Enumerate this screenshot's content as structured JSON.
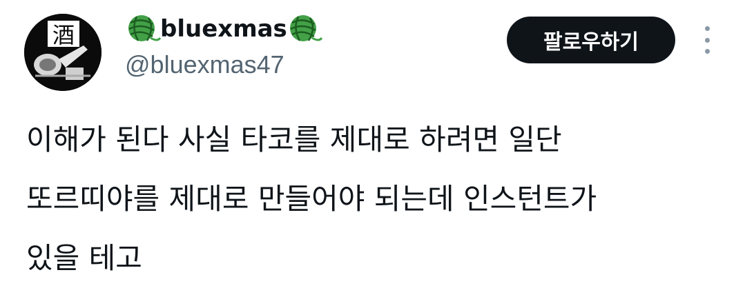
{
  "user": {
    "display_name": "bluexmas",
    "handle": "@bluexmas47",
    "avatar_char": "酒",
    "name_emoji": "yarn-emoji"
  },
  "actions": {
    "follow_label": "팔로우하기",
    "more_icon": "more-vertical-icon"
  },
  "tweet": {
    "lines": [
      "이해가 된다 사실 타코를 제대로 하려면 일단",
      "또르띠야를 제대로 만들어야 되는데 인스턴트가",
      "있을 테고"
    ]
  },
  "colors": {
    "button_bg": "#0f1419",
    "handle": "#536471",
    "yarn": "#43a047"
  }
}
